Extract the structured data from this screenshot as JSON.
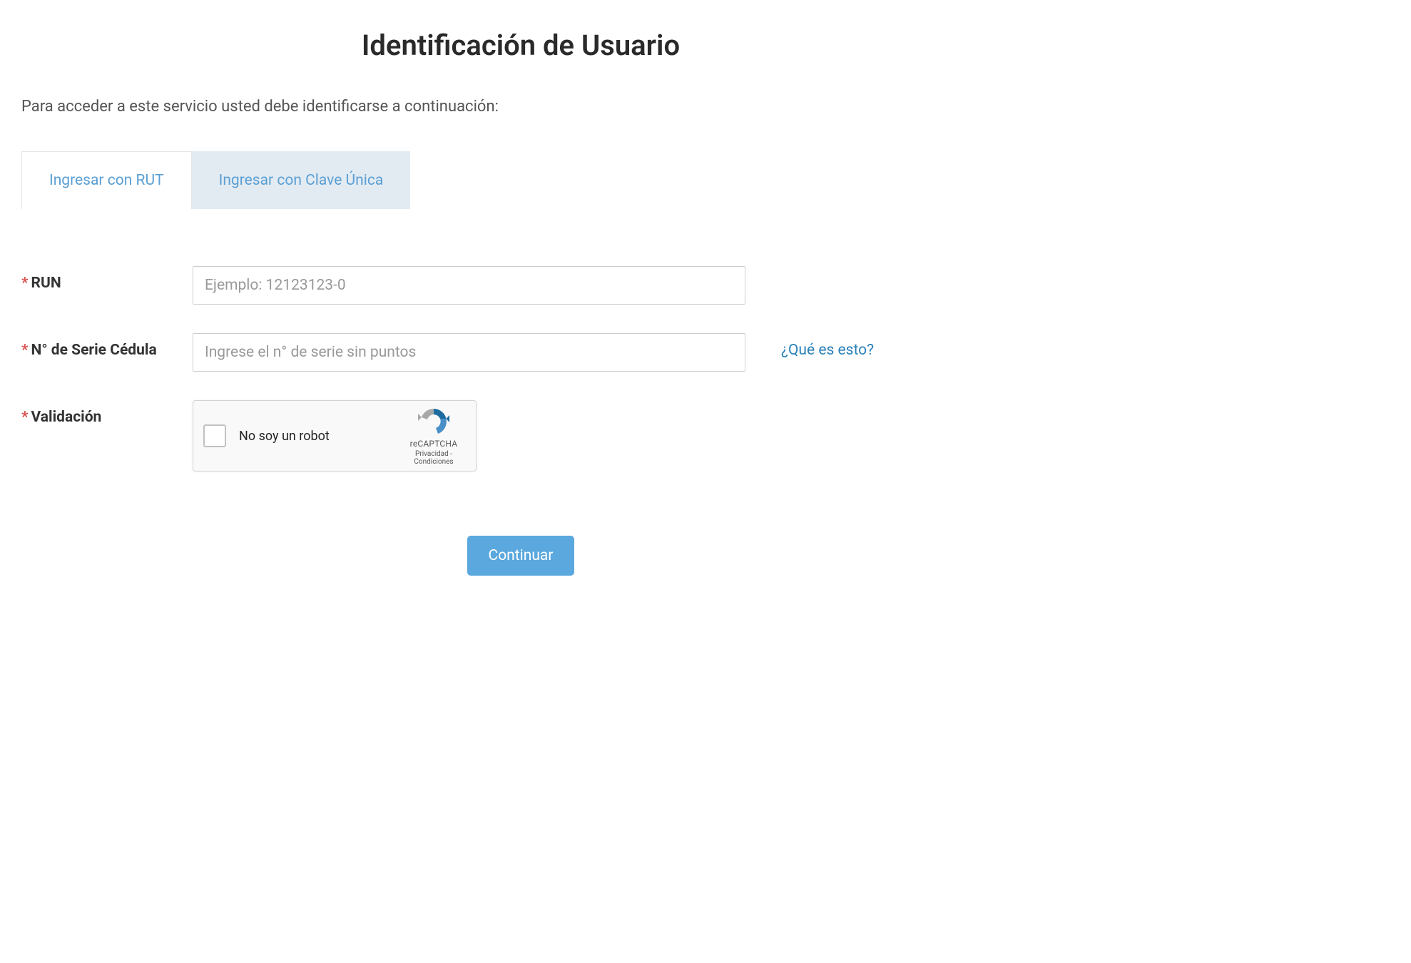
{
  "page": {
    "title": "Identificación de Usuario",
    "instruction": "Para acceder a este servicio usted debe identificarse a continuación:"
  },
  "tabs": [
    {
      "label": "Ingresar con RUT",
      "active": true
    },
    {
      "label": "Ingresar con Clave Única",
      "active": false
    }
  ],
  "form": {
    "run": {
      "label": "RUN",
      "placeholder": "Ejemplo: 12123123-0",
      "value": ""
    },
    "serie": {
      "label": "N° de Serie Cédula",
      "placeholder": "Ingrese el n° de serie sin puntos",
      "value": "",
      "help_link": "¿Qué es esto?"
    },
    "validacion": {
      "label": "Validación"
    },
    "submit_label": "Continuar"
  },
  "recaptcha": {
    "label": "No soy un robot",
    "brand": "reCAPTCHA",
    "privacy": "Privacidad",
    "separator": " - ",
    "terms": "Condiciones"
  }
}
